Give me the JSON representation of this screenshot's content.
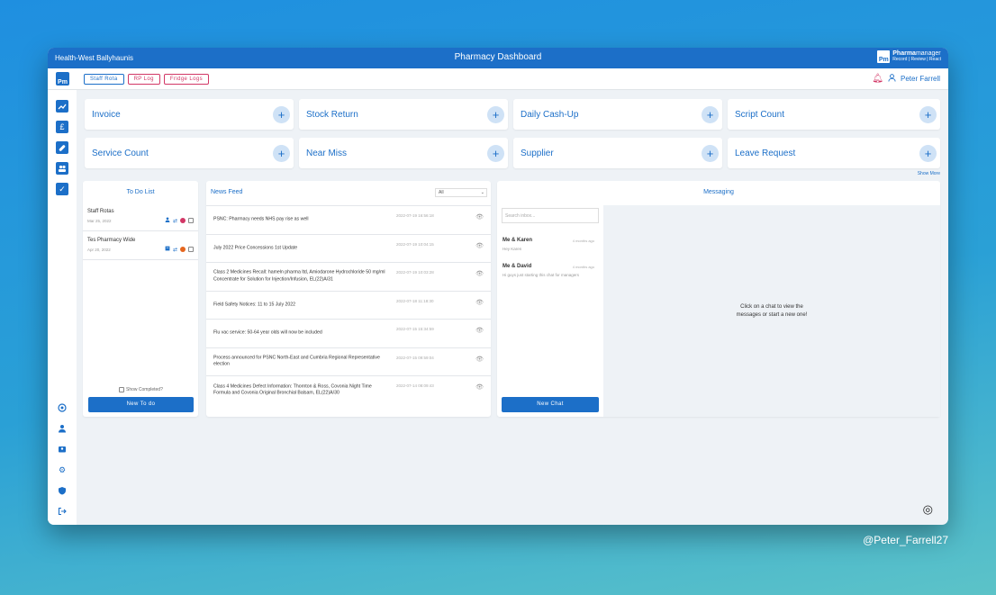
{
  "window": {
    "location": "Health-West Ballyhaunis",
    "title": "Pharmacy Dashboard"
  },
  "brand": {
    "logo": "Pm",
    "name_bold": "Pharma",
    "name_rest": "manager",
    "tagline": "Record | Review | React"
  },
  "topbar": {
    "logo": "Pm",
    "buttons": [
      "Staff Rota",
      "RP Log",
      "Fridge Logs"
    ],
    "user": "Peter Farrell"
  },
  "sidebar": {
    "top_icons": [
      "trend-icon",
      "pound-icon",
      "medication-icon",
      "group-icon",
      "check-icon"
    ],
    "bottom_icons": [
      "camera-icon",
      "person-icon",
      "contact-card-icon",
      "settings-icon",
      "security-icon",
      "logout-icon"
    ]
  },
  "tiles": [
    "Invoice",
    "Stock Return",
    "Daily Cash-Up",
    "Script Count",
    "Service Count",
    "Near Miss",
    "Supplier",
    "Leave Request"
  ],
  "show_more": "Show More",
  "todo": {
    "title": "To Do List",
    "items": [
      {
        "name": "Staff Rotas",
        "date": "Mar 25, 2022",
        "status_color": "#d23766"
      },
      {
        "name": "Tes Pharmacy Wide",
        "date": "Apr 20, 2022",
        "status_color": "#e5661e"
      }
    ],
    "show_completed": "Show Completed?",
    "new_button": "New To do"
  },
  "news": {
    "title": "News Feed",
    "filter": "All",
    "items": [
      {
        "title": "PSNC: Pharmacy needs NHS pay rise as well",
        "time": "2022-07-19 16:56:18"
      },
      {
        "title": "July 2022 Price Concessions 1st Update",
        "time": "2022-07-19 10:04:15"
      },
      {
        "title": "Class 2 Medicines Recall: hameln pharma ltd, Amiodarone Hydrochloride 50 mg/ml Concentrate for Solution for Injection/Infusion, EL(22)A/31",
        "time": "2022-07-19 10:03:28"
      },
      {
        "title": "Field Safety Notices: 11 to 15 July 2022",
        "time": "2022-07-18 11:18:30"
      },
      {
        "title": "Flu vac service: 50-64 year olds will now be included",
        "time": "2022-07-15 15:34:59"
      },
      {
        "title": "Process announced for PSNC North-East and Cumbria Regional Representative election",
        "time": "2022-07-15 09:59:04"
      },
      {
        "title": "Class 4 Medicines Defect Information: Thornton & Ross, Covonia Night Time Formula and Covonia Original Bronchial Balsam, EL(22)A/30",
        "time": "2022-07-14 08:09:43"
      }
    ]
  },
  "messaging": {
    "title": "Messaging",
    "search_placeholder": "Search inbox...",
    "chats": [
      {
        "name": "Me & Karen",
        "ago": "4 months ago",
        "preview": "Hey Karen"
      },
      {
        "name": "Me & David",
        "ago": "4 months ago",
        "preview": "Hi guys just starting this chat for managers"
      }
    ],
    "empty_text": "Click on a chat to view the messages or start a new one!",
    "new_button": "New Chat"
  },
  "watermark": "@Peter_Farrell27"
}
